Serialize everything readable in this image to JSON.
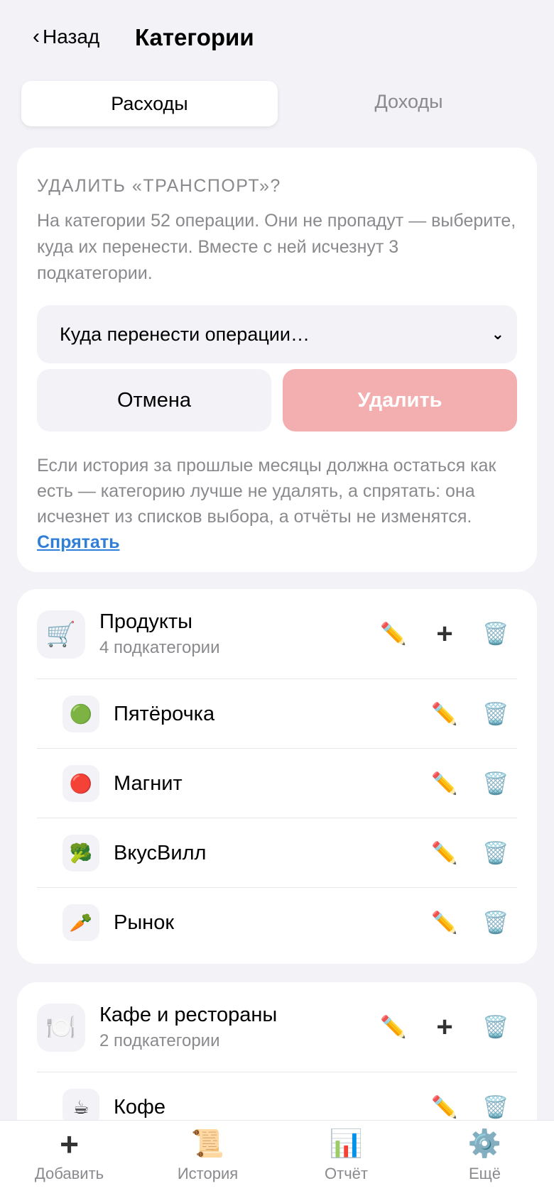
{
  "header": {
    "back_chevron": "‹",
    "back_label": "Назад",
    "title": "Категории"
  },
  "tabs": {
    "expenses": "Расходы",
    "income": "Доходы"
  },
  "delete_dialog": {
    "title": "УДАЛИТЬ «ТРАНСПОРТ»?",
    "text": "На категории 52 операции. Они не пропадут — выберите, куда их перенести. Вместе с ней исчезнут 3 подкатегории.",
    "select_placeholder": "Куда перенести операции…",
    "cancel": "Отмена",
    "delete": "Удалить",
    "hint": "Если история за прошлые месяцы должна остаться как есть — категорию лучше не удалять, а спрятать: она исчезнет из списков выбора, а отчёты не изменятся.",
    "hide_link": "Спрятать"
  },
  "groups": [
    {
      "name": "Продукты",
      "icon": "🛒",
      "subtitle": "4 подкатегории",
      "children": [
        {
          "name": "Пятёрочка",
          "icon": "🟢"
        },
        {
          "name": "Магнит",
          "icon": "🔴"
        },
        {
          "name": "ВкусВилл",
          "icon": "🥦"
        },
        {
          "name": "Рынок",
          "icon": "🥕"
        }
      ]
    },
    {
      "name": "Кафе и рестораны",
      "icon": "🍽️",
      "subtitle": "2 подкатегории",
      "children": [
        {
          "name": "Кофе",
          "icon": "☕"
        }
      ]
    }
  ],
  "action_icons": {
    "edit": "✏️",
    "add": "+",
    "delete": "🗑️"
  },
  "tabbar": [
    {
      "label": "Добавить",
      "icon": "+"
    },
    {
      "label": "История",
      "icon": "📜"
    },
    {
      "label": "Отчёт",
      "icon": "📊"
    },
    {
      "label": "Ещё",
      "icon": "⚙️"
    }
  ],
  "colors": {
    "link": "#2f7fd8",
    "delete_button": "#f3aeb0",
    "background": "#f2f2f7"
  }
}
